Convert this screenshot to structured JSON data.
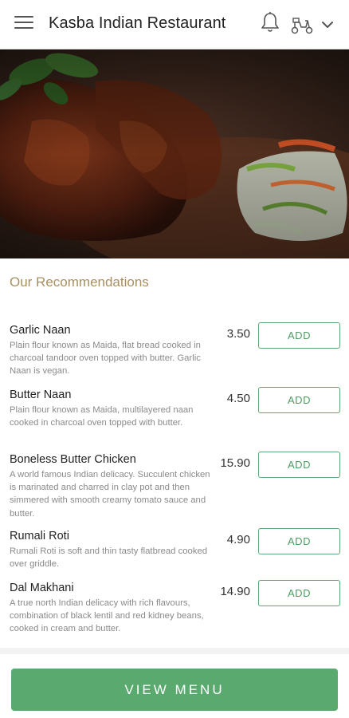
{
  "header": {
    "title": "Kasba Indian Restaurant",
    "menu_icon": "hamburger-menu-icon",
    "notification_icon": "bell-icon",
    "delivery_icon": "scooter-icon",
    "dropdown_icon": "chevron-down-icon"
  },
  "hero": {
    "image": "tandoori-chicken-photo"
  },
  "recommendations": {
    "title": "Our Recommendations",
    "items": [
      {
        "name": "Garlic Naan",
        "description": "Plain flour known as Maida, flat bread cooked in charcoal tandoor oven topped with butter. Garlic Naan is vegan.",
        "price": "3.50",
        "button": "ADD"
      },
      {
        "name": "Butter Naan",
        "description": "Plain flour known as Maida, multilayered naan cooked in charcoal oven topped with butter.",
        "price": "4.50",
        "button": "ADD"
      },
      {
        "name": "Boneless Butter Chicken",
        "description": "A world famous Indian delicacy. Succulent chicken is marinated and charred in clay pot and then simmered with smooth creamy tomato sauce and butter.",
        "price": "15.90",
        "button": "ADD"
      },
      {
        "name": "Rumali Roti",
        "description": "Rumali Roti is soft and thin tasty flatbread cooked over griddle.",
        "price": "4.90",
        "button": "ADD"
      },
      {
        "name": "Dal Makhani",
        "description": "A true north Indian delicacy with rich flavours, combination of black lentil and red kidney beans, cooked in cream and butter.",
        "price": "14.90",
        "button": "ADD"
      }
    ]
  },
  "footer": {
    "view_menu_label": "VIEW MENU"
  },
  "colors": {
    "accent_green": "#5aa96f",
    "section_title": "#a89060"
  }
}
